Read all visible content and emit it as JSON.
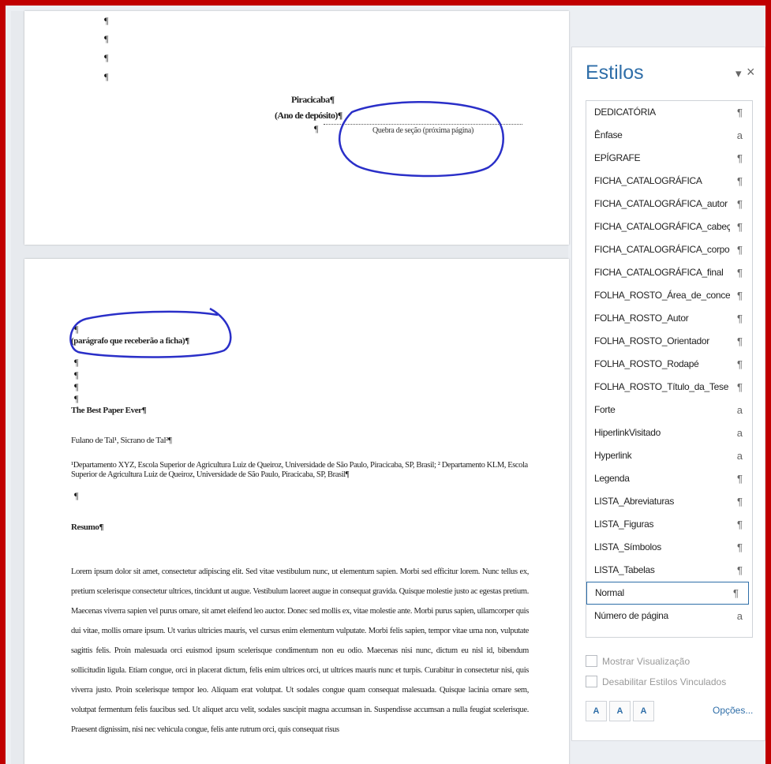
{
  "document": {
    "page1": {
      "city_line": "Piracicaba¶",
      "year_line": "(Ano de depósito)¶",
      "section_break_mark": "¶",
      "section_break_label": "Quebra de seção (próxima página)",
      "pilcrow": "¶"
    },
    "page2": {
      "pilcrow": "¶",
      "ficha_note": "(parágrafo que receberão a ficha)¶",
      "paper_title": "The Best Paper Ever¶",
      "authors": "Fulano de Tal¹, Sicrano de Tal²¶",
      "affiliations": "¹Departamento XYZ, Escola Superior de Agricultura Luiz de Queiroz, Universidade de São Paulo, Piracicaba, SP, Brasil; ² Departamento KLM, Escola Superior de Agricultura Luiz de Queiroz, Universidade de São Paulo, Piracicaba, SP, Brasil¶",
      "abstract_heading": "Resumo¶",
      "abstract_body": "Lorem ipsum dolor sit amet, consectetur adipiscing elit. Sed vitae vestibulum nunc, ut elementum sapien. Morbi sed efficitur lorem. Nunc tellus ex, pretium scelerisque consectetur ultrices, tincidunt ut augue. Vestibulum laoreet augue in consequat gravida. Quisque molestie justo ac egestas pretium. Maecenas viverra sapien vel purus ornare, sit amet eleifend leo auctor. Donec sed mollis ex, vitae molestie ante. Morbi purus sapien, ullamcorper quis dui vitae, mollis ornare ipsum. Ut varius ultricies mauris, vel cursus enim elementum vulputate. Morbi felis sapien, tempor vitae urna non, vulputate sagittis felis. Proin malesuada orci euismod ipsum scelerisque condimentum non eu odio. Maecenas nisi nunc, dictum eu nisl id, bibendum sollicitudin ligula. Etiam congue, orci in placerat dictum, felis enim ultrices orci, ut ultrices mauris nunc et turpis. Curabitur in consectetur nisi, quis viverra justo. Proin scelerisque tempor leo. Aliquam erat volutpat. Ut sodales congue quam consequat malesuada. Quisque lacinia ornare sem, volutpat fermentum felis faucibus sed. Ut aliquet arcu velit, sodales suscipit magna accumsan in. Suspendisse accumsan a nulla feugiat scelerisque. Praesent dignissim, nisi nec vehicula congue, felis ante rutrum orci, quis consequat risus"
    }
  },
  "styles_pane": {
    "title": "Estilos",
    "menu_glyph": "▾",
    "close_glyph": "×",
    "items": [
      {
        "name": "DEDICATÓRIA",
        "mark": "¶"
      },
      {
        "name": "Ênfase",
        "mark": "a"
      },
      {
        "name": "EPÍGRAFE",
        "mark": "¶"
      },
      {
        "name": "FICHA_CATALOGRÁFICA",
        "mark": "¶"
      },
      {
        "name": "FICHA_CATALOGRÁFICA_autor",
        "mark": "¶"
      },
      {
        "name": "FICHA_CATALOGRÁFICA_cabeçalho",
        "mark": "¶"
      },
      {
        "name": "FICHA_CATALOGRÁFICA_corpo",
        "mark": "¶"
      },
      {
        "name": "FICHA_CATALOGRÁFICA_final",
        "mark": "¶"
      },
      {
        "name": "FOLHA_ROSTO_Área_de_concentração",
        "mark": "¶"
      },
      {
        "name": "FOLHA_ROSTO_Autor",
        "mark": "¶"
      },
      {
        "name": "FOLHA_ROSTO_Orientador",
        "mark": "¶"
      },
      {
        "name": "FOLHA_ROSTO_Rodapé",
        "mark": "¶"
      },
      {
        "name": "FOLHA_ROSTO_Título_da_Tese",
        "mark": "¶"
      },
      {
        "name": "Forte",
        "mark": "a"
      },
      {
        "name": "HiperlinkVisitado",
        "mark": "a"
      },
      {
        "name": "Hyperlink",
        "mark": "a"
      },
      {
        "name": "Legenda",
        "mark": "¶"
      },
      {
        "name": "LISTA_Abreviaturas",
        "mark": "¶"
      },
      {
        "name": "LISTA_Figuras",
        "mark": "¶"
      },
      {
        "name": "LISTA_Símbolos",
        "mark": "¶"
      },
      {
        "name": "LISTA_Tabelas",
        "mark": "¶"
      },
      {
        "name": "Normal",
        "mark": "¶",
        "selected": true
      },
      {
        "name": "Número de página",
        "mark": "a"
      }
    ],
    "show_preview_label": "Mostrar Visualização",
    "disable_linked_label": "Desabilitar Estilos Vinculados",
    "new_style_btn": "A",
    "style_inspector_btn": "A",
    "manage_styles_btn": "A",
    "options_label": "Opções..."
  },
  "colors": {
    "frame_border": "#c00000",
    "annotation_ink": "#2a2fc8",
    "pane_accent": "#2f6ea8"
  }
}
